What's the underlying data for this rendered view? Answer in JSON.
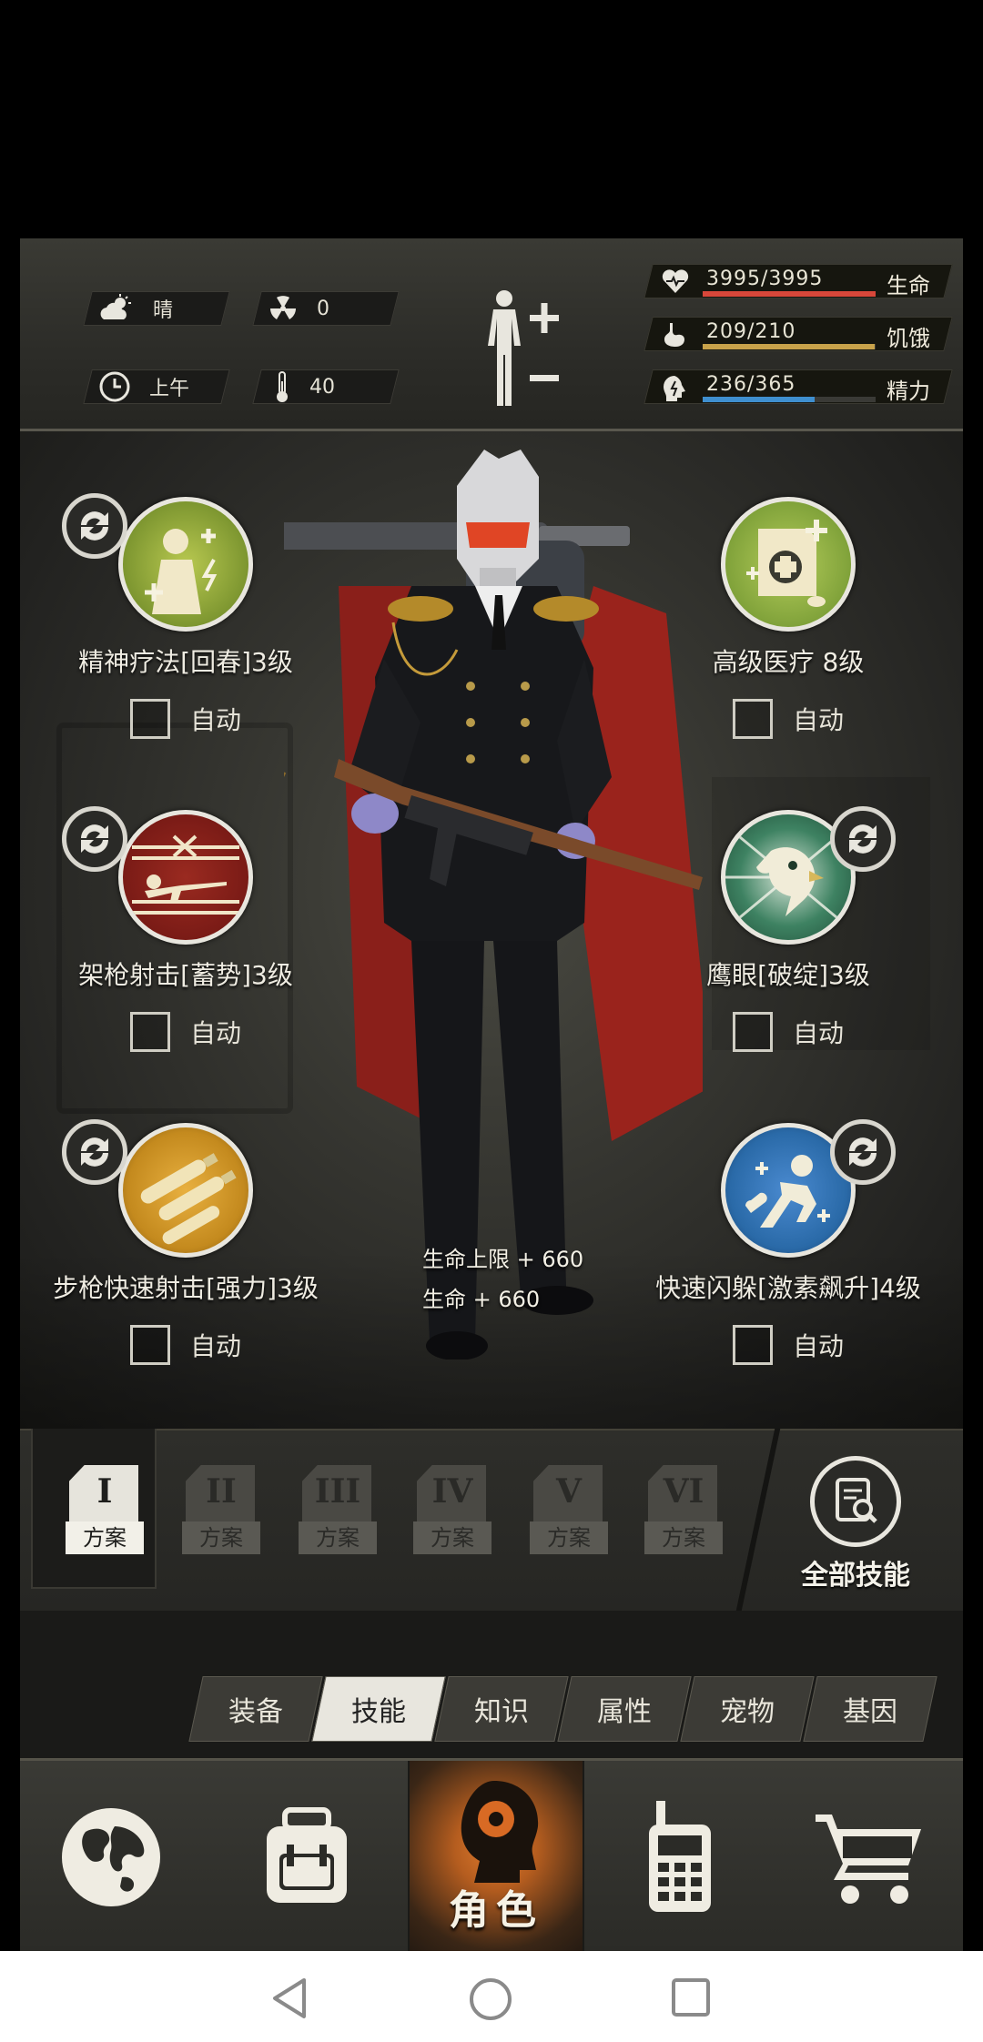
{
  "status": {
    "weather": {
      "icon": "cloud-sun-icon",
      "label": "晴"
    },
    "radiation": {
      "icon": "radiation-icon",
      "value": "0"
    },
    "time": {
      "icon": "clock-icon",
      "label": "上午"
    },
    "temperature": {
      "icon": "thermometer-icon",
      "value": "40"
    },
    "stats": [
      {
        "icon": "heart-icon",
        "value": "3995/3995",
        "label": "生命",
        "fraction": 1.0,
        "color": "#d8473a"
      },
      {
        "icon": "stomach-icon",
        "value": "209/210",
        "label": "饥饿",
        "fraction": 0.995,
        "color": "#c8a24a"
      },
      {
        "icon": "brain-icon",
        "value": "236/365",
        "label": "精力",
        "fraction": 0.647,
        "color": "#3f8fcf"
      }
    ]
  },
  "skills": [
    {
      "name": "精神疗法[回春]3级",
      "icon": "mental-therapy-icon",
      "auto": "自动",
      "color": "#8aa236"
    },
    {
      "name": "高级医疗 8级",
      "icon": "advanced-medical-icon",
      "auto": "自动",
      "color": "#7da03a"
    },
    {
      "name": "架枪射击[蓄势]3级",
      "icon": "mounted-shot-icon",
      "auto": "自动",
      "color": "#7a1b16"
    },
    {
      "name": "鹰眼[破绽]3级",
      "icon": "eagle-eye-icon",
      "auto": "自动",
      "color": "#2e6b4e"
    },
    {
      "name": "步枪快速射击[强力]3级",
      "icon": "rifle-rapid-fire-icon",
      "auto": "自动",
      "color": "#c48a1e"
    },
    {
      "name": "快速闪躲[激素飙升]4级",
      "icon": "quick-dodge-icon",
      "auto": "自动",
      "color": "#2a6aa8"
    }
  ],
  "buffs": [
    "生命上限 + 660",
    "生命 + 660"
  ],
  "plans": [
    {
      "num": "I",
      "label": "方案"
    },
    {
      "num": "II",
      "label": "方案"
    },
    {
      "num": "III",
      "label": "方案"
    },
    {
      "num": "IV",
      "label": "方案"
    },
    {
      "num": "V",
      "label": "方案"
    },
    {
      "num": "VI",
      "label": "方案"
    }
  ],
  "all_skills_label": "全部技能",
  "tabs": [
    "装备",
    "技能",
    "知识",
    "属性",
    "宠物",
    "基因"
  ],
  "active_tab": "技能",
  "nav": {
    "active_label": "角色",
    "items": [
      "globe-icon",
      "backpack-icon",
      "character-icon",
      "walkie-talkie-icon",
      "shopping-cart-icon"
    ]
  }
}
